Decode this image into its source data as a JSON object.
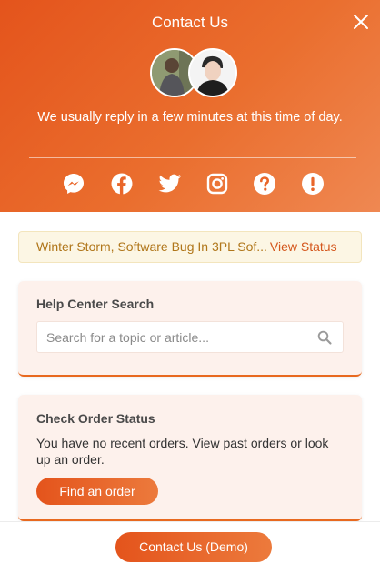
{
  "header": {
    "title": "Contact Us",
    "subtitle": "We usually reply in a few minutes at this time of day.",
    "close_icon": "close-icon",
    "socials": [
      {
        "name": "Messenger",
        "icon": "messenger-icon"
      },
      {
        "name": "Facebook",
        "icon": "facebook-icon"
      },
      {
        "name": "Twitter",
        "icon": "twitter-icon"
      },
      {
        "name": "Instagram",
        "icon": "instagram-icon"
      },
      {
        "name": "Help",
        "icon": "question-circle-icon"
      },
      {
        "name": "Alert",
        "icon": "exclamation-circle-icon"
      }
    ]
  },
  "banner": {
    "text": "Winter Storm, Software Bug In 3PL Sof...",
    "link": "View Status"
  },
  "search_card": {
    "title": "Help Center Search",
    "placeholder": "Search for a topic or article...",
    "value": ""
  },
  "order_card": {
    "title": "Check Order Status",
    "description": "You have no recent orders. View past orders or look up an order.",
    "button": "Find an order"
  },
  "footer": {
    "button": "Contact Us (Demo)"
  },
  "colors": {
    "brand": "#e4541c",
    "brand_light": "#ef8852",
    "banner_bg": "#fcf6e4",
    "card_bg": "#fdf1ec"
  }
}
